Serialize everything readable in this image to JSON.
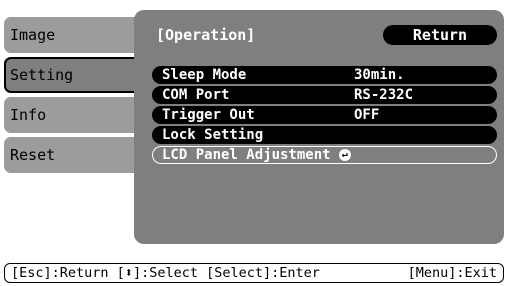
{
  "sidebar": {
    "items": [
      {
        "label": "Image"
      },
      {
        "label": "Setting"
      },
      {
        "label": "Info"
      },
      {
        "label": "Reset"
      }
    ]
  },
  "header": {
    "title": "[Operation]",
    "return_label": "Return"
  },
  "settings": [
    {
      "label": "Sleep Mode",
      "value": "30min."
    },
    {
      "label": "COM Port",
      "value": "RS-232C"
    },
    {
      "label": "Trigger Out",
      "value": "OFF"
    },
    {
      "label": "Lock Setting",
      "value": ""
    },
    {
      "label": "LCD Panel Adjustment",
      "value": ""
    }
  ],
  "footer": {
    "left_pre": "[Esc]:Return [",
    "left_post": "]:Select [Select]:Enter",
    "right": "[Menu]:Exit"
  }
}
